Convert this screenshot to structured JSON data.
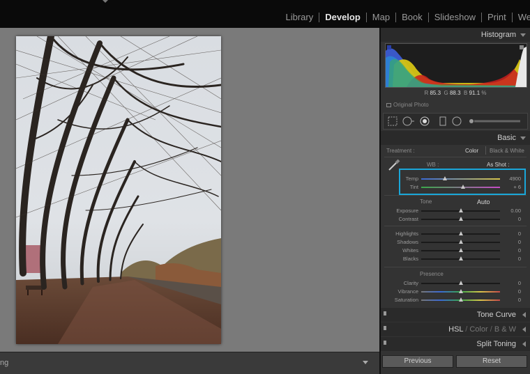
{
  "topbar": {
    "modules": [
      "Library",
      "Develop",
      "Map",
      "Book",
      "Slideshow",
      "Print",
      "We"
    ],
    "active": "Develop"
  },
  "bottombar": {
    "label": "ng"
  },
  "histogram": {
    "title": "Histogram",
    "r_label": "R",
    "r_value": "85.3",
    "g_label": "G",
    "g_value": "88.3",
    "b_label": "B",
    "b_value": "91.1",
    "unit": "%",
    "original_photo": "Original Photo"
  },
  "basic": {
    "title": "Basic",
    "treatment_label": "Treatment :",
    "treatment_color": "Color",
    "treatment_bw": "Black & White",
    "wb_label": "WB :",
    "wb_value": "As Shot :",
    "tone_label": "Tone",
    "auto_label": "Auto",
    "presence_label": "Presence",
    "sliders": {
      "temp": {
        "label": "Temp",
        "value": "4900",
        "level": 0.3
      },
      "tint": {
        "label": "Tint",
        "value": "+ 6",
        "level": 0.53
      },
      "exposure": {
        "label": "Exposure",
        "value": "0.00",
        "level": 0.5
      },
      "contrast": {
        "label": "Contrast",
        "value": "0",
        "level": 0.5
      },
      "highlights": {
        "label": "Highlights",
        "value": "0",
        "level": 0.5
      },
      "shadows": {
        "label": "Shadows",
        "value": "0",
        "level": 0.5
      },
      "whites": {
        "label": "Whites",
        "value": "0",
        "level": 0.5
      },
      "blacks": {
        "label": "Blacks",
        "value": "0",
        "level": 0.5
      },
      "clarity": {
        "label": "Clarity",
        "value": "0",
        "level": 0.5
      },
      "vibrance": {
        "label": "Vibrance",
        "value": "0",
        "level": 0.5
      },
      "saturation": {
        "label": "Saturation",
        "value": "0",
        "level": 0.5
      }
    }
  },
  "panels": {
    "tone_curve": "Tone Curve",
    "hsl": "HSL",
    "color": "Color",
    "bw": "B & W",
    "split_toning": "Split Toning"
  },
  "buttons": {
    "previous": "Previous",
    "reset": "Reset"
  },
  "colors": {
    "highlight_box": "#1aa7d9",
    "canvas": "#7a7a7a",
    "panel": "#333333"
  }
}
